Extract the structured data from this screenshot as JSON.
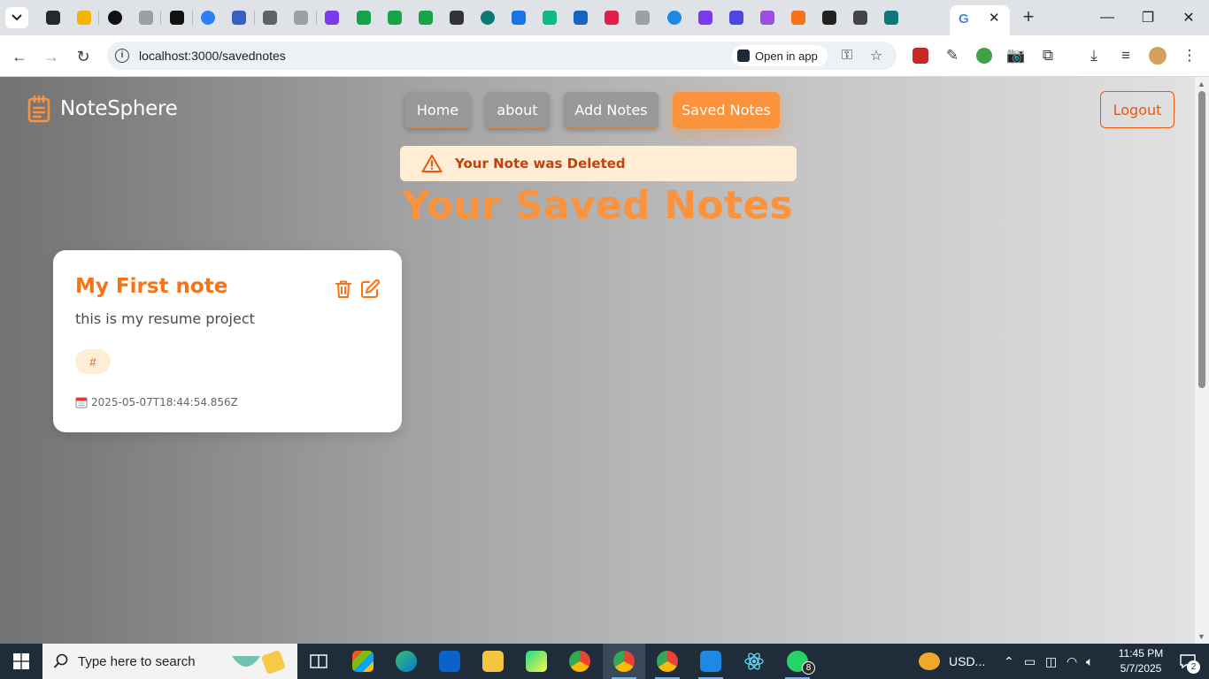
{
  "browser": {
    "url": "localhost:3000/savednotes",
    "open_in_app_label": "Open in app",
    "active_tab_icon": "google-g-icon",
    "pinned_tab_colors": [
      "#24292f",
      "#f4b400",
      "#111111",
      "#9aa0a6",
      "#111111",
      "#2d7ff9",
      "#3b5fbf",
      "#5f6368",
      "#9aa0a6",
      "#7c3aed",
      "#16a34a",
      "#16a34a",
      "#16a34a",
      "#333333",
      "#0b7a75",
      "#1a73e8",
      "#10b981",
      "#1565c0",
      "#e11d48",
      "#9aa0a6",
      "#1e88e5",
      "#7c3aed",
      "#4f46e5",
      "#9d4edd",
      "#f97316",
      "#222222",
      "#444444",
      "#0b7a75"
    ]
  },
  "app": {
    "brand": "NoteSphere",
    "nav": {
      "home": "Home",
      "about": "about",
      "add_notes": "Add Notes",
      "saved_notes": "Saved Notes",
      "logout": "Logout"
    },
    "alert": "Your Note was Deleted",
    "page_title": "Your Saved Notes",
    "accent_color": "#fb923c",
    "notes": [
      {
        "title": "My First note",
        "description": "this is my resume project",
        "tag": "#",
        "date": "2025-05-07T18:44:54.856Z"
      }
    ]
  },
  "taskbar": {
    "search_placeholder": "Type here to search",
    "tray_label": "USD...",
    "time": "11:45 PM",
    "date": "5/7/2025",
    "whatsapp_badge": "8",
    "notification_count": "2"
  }
}
